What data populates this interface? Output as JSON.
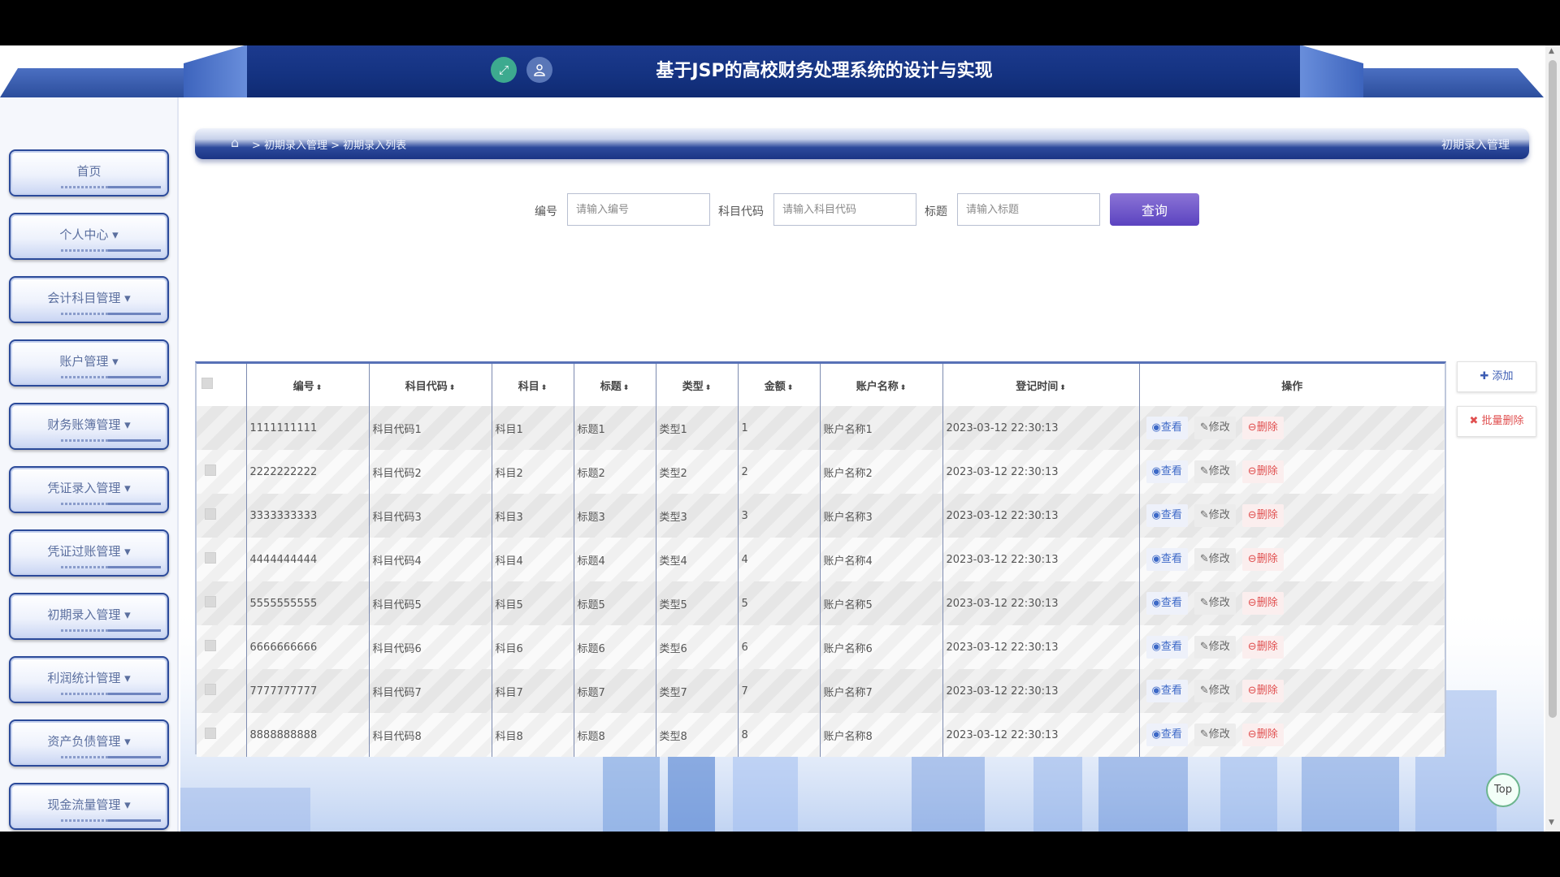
{
  "header": {
    "title": "基于JSP的高校财务处理系统的设计与实现",
    "expand_icon": "expand-icon",
    "user_icon": "user-icon"
  },
  "sidebar": {
    "items": [
      {
        "label": "首页"
      },
      {
        "label": "个人中心 ▾"
      },
      {
        "label": "会计科目管理 ▾"
      },
      {
        "label": "账户管理 ▾"
      },
      {
        "label": "财务账簿管理 ▾"
      },
      {
        "label": "凭证录入管理 ▾"
      },
      {
        "label": "凭证过账管理 ▾"
      },
      {
        "label": "初期录入管理 ▾"
      },
      {
        "label": "利润统计管理 ▾"
      },
      {
        "label": "资产负债管理 ▾"
      },
      {
        "label": "现金流量管理 ▾"
      }
    ]
  },
  "breadcrumb": {
    "path": "> 初期录入管理 > 初期录入列表",
    "right": "初期录入管理"
  },
  "search": {
    "label_code": "编号",
    "placeholder_code": "请输入编号",
    "label_subject_code": "科目代码",
    "placeholder_subject_code": "请输入科目代码",
    "label_title": "标题",
    "placeholder_title": "请输入标题",
    "button": "查询"
  },
  "table": {
    "headers": [
      "编号",
      "科目代码",
      "科目",
      "标题",
      "类型",
      "金额",
      "账户名称",
      "登记时间",
      "操作"
    ],
    "rows": [
      [
        "1111111111",
        "科目代码1",
        "科目1",
        "标题1",
        "类型1",
        "1",
        "账户名称1",
        "2023-03-12 22:30:13"
      ],
      [
        "2222222222",
        "科目代码2",
        "科目2",
        "标题2",
        "类型2",
        "2",
        "账户名称2",
        "2023-03-12 22:30:13"
      ],
      [
        "3333333333",
        "科目代码3",
        "科目3",
        "标题3",
        "类型3",
        "3",
        "账户名称3",
        "2023-03-12 22:30:13"
      ],
      [
        "4444444444",
        "科目代码4",
        "科目4",
        "标题4",
        "类型4",
        "4",
        "账户名称4",
        "2023-03-12 22:30:13"
      ],
      [
        "5555555555",
        "科目代码5",
        "科目5",
        "标题5",
        "类型5",
        "5",
        "账户名称5",
        "2023-03-12 22:30:13"
      ],
      [
        "6666666666",
        "科目代码6",
        "科目6",
        "标题6",
        "类型6",
        "6",
        "账户名称6",
        "2023-03-12 22:30:13"
      ],
      [
        "7777777777",
        "科目代码7",
        "科目7",
        "标题7",
        "类型7",
        "7",
        "账户名称7",
        "2023-03-12 22:30:13"
      ],
      [
        "8888888888",
        "科目代码8",
        "科目8",
        "标题8",
        "类型8",
        "8",
        "账户名称8",
        "2023-03-12 22:30:13"
      ]
    ],
    "ops": {
      "view": "查看",
      "edit": "修改",
      "delete": "删除"
    }
  },
  "side_ops": {
    "add": "添加",
    "batch_delete": "批量删除"
  },
  "top_button": "Top",
  "colors": {
    "header_bg": "#143280",
    "search_button": "#6b55c9",
    "view_text": "#3d69c7",
    "delete_text": "#e04f4f"
  }
}
